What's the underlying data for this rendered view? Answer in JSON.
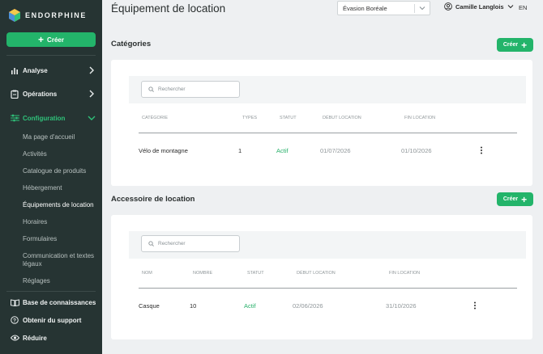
{
  "sidebar": {
    "brand": "ENDORPHINE",
    "create_label": "Créer",
    "nav": {
      "analyse": "Analyse",
      "operations": "Opérations",
      "configuration": "Configuration"
    },
    "config_items": [
      "Ma page d'accueil",
      "Activités",
      "Catalogue de produits",
      "Hébergement",
      "Équipements de location",
      "Horaires",
      "Formulaires",
      "Communication et textes légaux",
      "Réglages"
    ],
    "footer": {
      "knowledge": "Base de connaissances",
      "support": "Obtenir du support",
      "collapse": "Réduire"
    }
  },
  "header": {
    "title": "Équipement de location",
    "org_select": "Évasion Boréale",
    "user_name": "Camille Langlois",
    "lang": "EN"
  },
  "categories": {
    "title": "Catégories",
    "add_label": "Créer",
    "search_placeholder": "Rechercher",
    "columns": [
      "CATÉGORIE",
      "TYPES",
      "STATUT",
      "DÉBUT LOCATION",
      "FIN LOCATION"
    ],
    "rows": [
      {
        "name": "Vélo de montagne",
        "types": "1",
        "status": "Actif",
        "start": "01/07/2026",
        "end": "01/10/2026"
      }
    ]
  },
  "accessories": {
    "title": "Accessoire de location",
    "add_label": "Créer",
    "search_placeholder": "Rechercher",
    "columns": [
      "NOM",
      "NOMBRE",
      "STATUT",
      "DÉBUT LOCATION",
      "FIN LOCATION"
    ],
    "rows": [
      {
        "name": "Casque",
        "count": "10",
        "status": "Actif",
        "start": "02/06/2026",
        "end": "31/10/2026"
      }
    ]
  },
  "colors": {
    "sidebar_bg": "#263433",
    "accent_green": "#23b46a",
    "status_active": "#27b06a",
    "page_bg": "#eef0f2"
  }
}
